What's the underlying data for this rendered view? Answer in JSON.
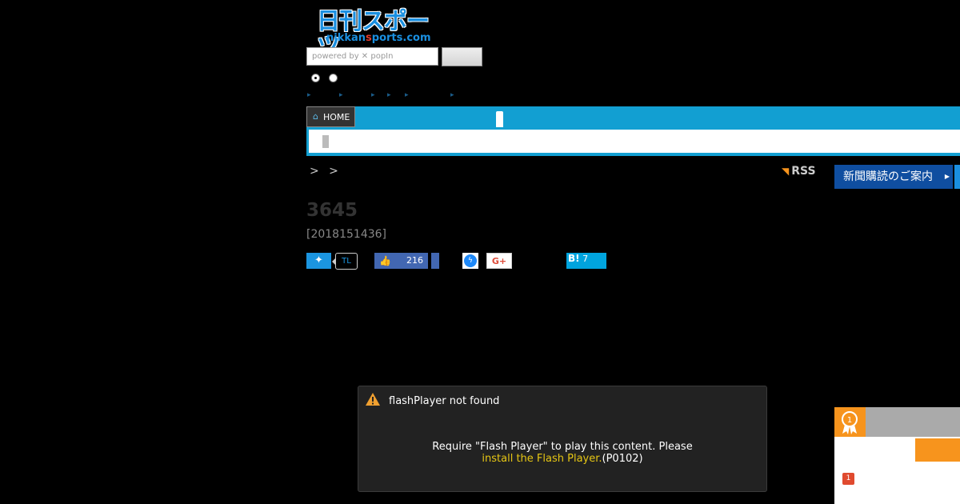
{
  "header": {
    "logo_main": "日刊スポーツ",
    "logo_sub_left": "nikkan",
    "logo_sub_red": "s",
    "logo_sub_right": "ports.com",
    "search_placeholder": "powered by ✕ popIn",
    "search_button_label": ""
  },
  "nav": {
    "home_label": "HOME"
  },
  "breadcrumb": {
    "text": "> >"
  },
  "rss_label": "RSS",
  "subscription_button_label": "新聞購読のご案内",
  "article": {
    "title": "3645",
    "date": "[2018151436]"
  },
  "share": {
    "twitter_icon": "twitter-bird-icon",
    "twitter_count": "TL",
    "facebook_count": "216",
    "googleplus_label": "G+",
    "hatena_label": "B!",
    "hatena_count": "7"
  },
  "flash_dialog": {
    "title": "flashPlayer not found",
    "message": "Require \"Flash Player\" to play this content. Please",
    "link_text": "install the Flash Player.",
    "code": "(P0102)"
  },
  "ranking": {
    "first_rank": "1"
  },
  "colors": {
    "nav_blue": "#129fd2",
    "subscribe_blue": "#0f4ea0",
    "ranking_orange": "#f7941d",
    "flash_link": "#e6c614"
  }
}
